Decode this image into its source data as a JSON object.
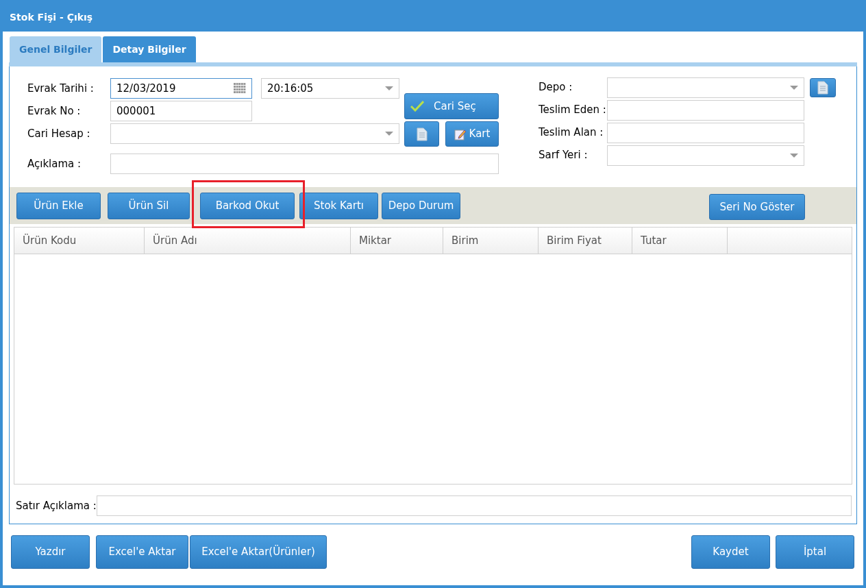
{
  "window": {
    "title": "Stok Fişi - Çıkış"
  },
  "tabs": [
    {
      "label": "Genel Bilgiler",
      "selected": true
    },
    {
      "label": "Detay Bilgiler",
      "selected": false
    }
  ],
  "form_left": {
    "evrak_tarihi": {
      "label": "Evrak Tarihi :",
      "value": "12/03/2019",
      "time": "20:16:05"
    },
    "evrak_no": {
      "label": "Evrak No :",
      "value": "000001"
    },
    "cari_hesap": {
      "label": "Cari Hesap :"
    },
    "aciklama": {
      "label": "Açıklama :"
    },
    "cari_sec_button": "Cari Seç",
    "kart_button": "Kart"
  },
  "form_right": [
    {
      "label": "Depo :",
      "kind": "dropdown"
    },
    {
      "label": "Teslim Eden :",
      "kind": "text"
    },
    {
      "label": "Teslim Alan :",
      "kind": "text"
    },
    {
      "label": "Sarf Yeri :",
      "kind": "dropdown"
    }
  ],
  "toolbar": [
    {
      "label": "Ürün Ekle",
      "highlighted": false
    },
    {
      "label": "Ürün Sil",
      "highlighted": false
    },
    {
      "label": "Barkod Okut",
      "highlighted": true
    },
    {
      "label": "Stok Kartı",
      "highlighted": false
    },
    {
      "label": "Depo Durum",
      "highlighted": false
    }
  ],
  "toolbar_right": "Seri No Göster",
  "table": {
    "columns": [
      "Ürün Kodu",
      "Ürün Adı",
      "Miktar",
      "Birim",
      "Birim Fiyat",
      "Tutar"
    ]
  },
  "satir_aciklama": {
    "label": "Satır Açıklama :"
  },
  "footer_left": [
    "Yazdır",
    "Excel'e Aktar",
    "Excel'e Aktar(Ürünler)"
  ],
  "footer_right": [
    "Kaydet",
    "İptal"
  ]
}
